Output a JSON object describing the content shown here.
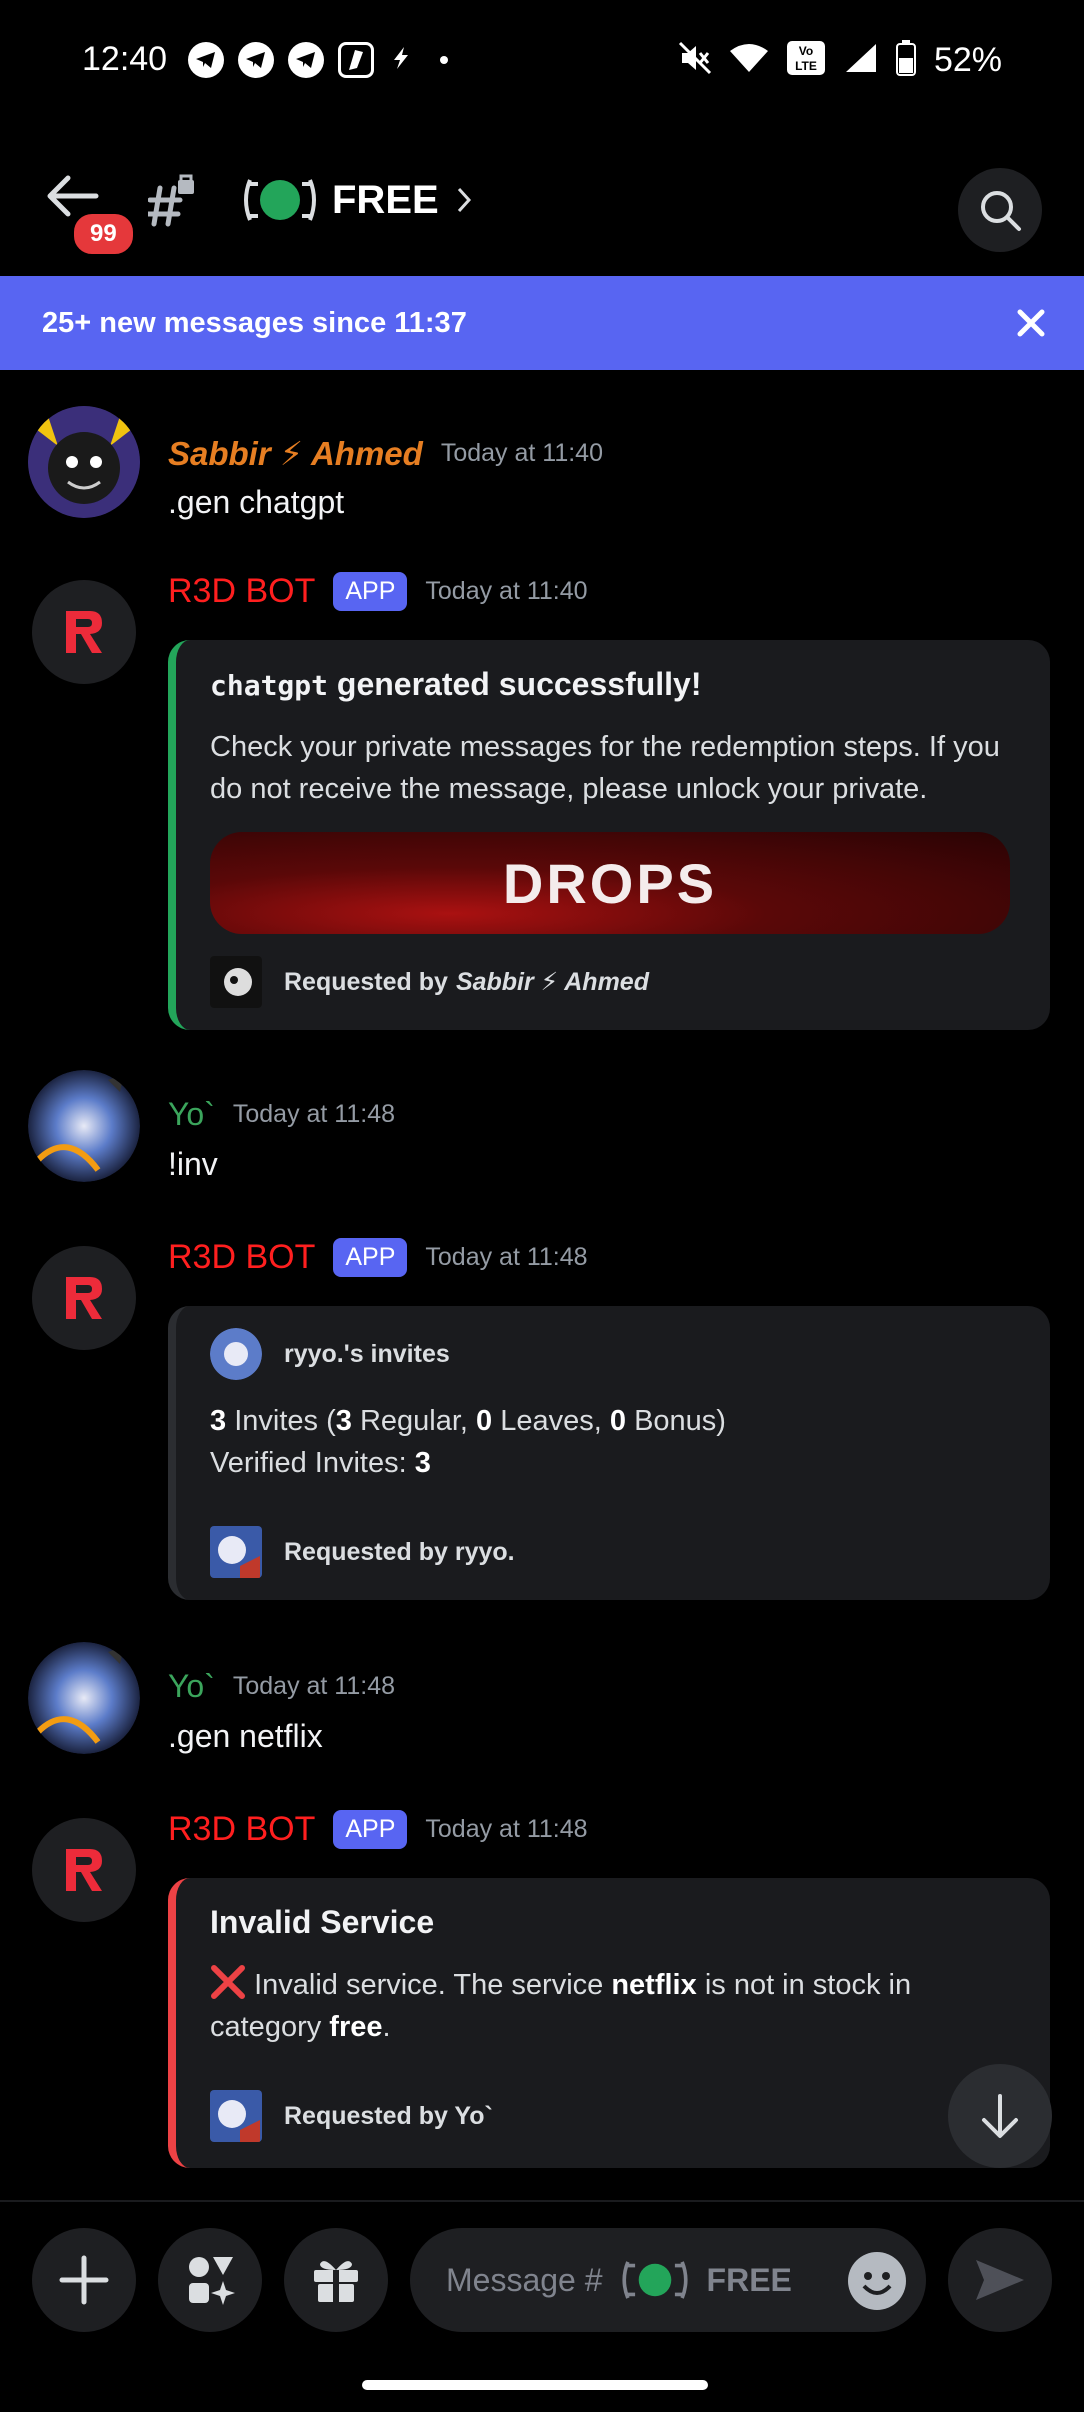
{
  "status_bar": {
    "time": "12:40",
    "battery": "52%"
  },
  "header": {
    "badge": "99",
    "channel_name": "FREE"
  },
  "banner": {
    "text": "25+ new messages since 11:37"
  },
  "messages": [
    {
      "author": "Sabbir ⚡ Ahmed",
      "time": "Today at 11:40",
      "text": ".gen chatgpt"
    },
    {
      "author": "R3D BOT",
      "tag": "APP",
      "time": "Today at 11:40",
      "embed": {
        "title_code": "chatgpt",
        "title_rest": "generated successfully!",
        "description": "Check your private messages for the redemption steps. If you do not receive the message, please unlock your private.",
        "image_text": "DROPS",
        "footer_prefix": "Requested by",
        "footer_name": "Sabbir ⚡ Ahmed"
      }
    },
    {
      "author": "Yo`",
      "time": "Today at 11:48",
      "text": "!inv"
    },
    {
      "author": "R3D BOT",
      "tag": "APP",
      "time": "Today at 11:48",
      "embed": {
        "header": "ryyo.'s invites",
        "invites": "3",
        "invites_label": "Invites (",
        "regular": "3",
        "regular_label": "Regular,",
        "leaves": "0",
        "leaves_label": "Leaves,",
        "bonus": "0",
        "bonus_label": "Bonus)",
        "verified_label": "Verified Invites:",
        "verified": "3",
        "footer": "Requested by ryyo."
      }
    },
    {
      "author": "Yo`",
      "time": "Today at 11:48",
      "text": ".gen netflix"
    },
    {
      "author": "R3D BOT",
      "tag": "APP",
      "time": "Today at 11:48",
      "embed": {
        "title": "Invalid Service",
        "desc_1": "Invalid service. The service",
        "desc_bold_1": "netflix",
        "desc_2": "is not in stock in category",
        "desc_bold_2": "free",
        "desc_3": ".",
        "footer": "Requested by Yo`"
      }
    }
  ],
  "composer": {
    "placeholder": "Message #",
    "channel": "FREE"
  }
}
